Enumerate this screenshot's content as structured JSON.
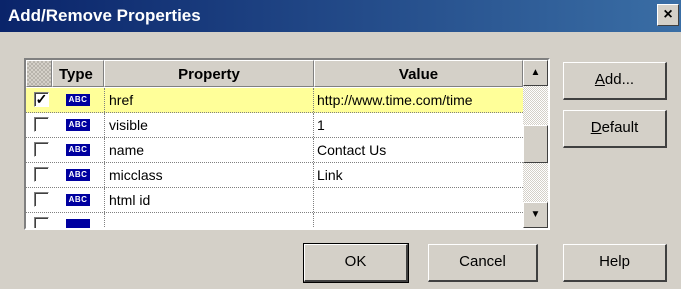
{
  "window": {
    "title": "Add/Remove Properties",
    "close_glyph": "×"
  },
  "grid": {
    "columns": {
      "type": "Type",
      "property": "Property",
      "value": "Value"
    },
    "rows": [
      {
        "checked": true,
        "type_badge": "ABC",
        "property": "href",
        "value": "http://www.time.com/time"
      },
      {
        "checked": false,
        "type_badge": "ABC",
        "property": "visible",
        "value": "1"
      },
      {
        "checked": false,
        "type_badge": "ABC",
        "property": "name",
        "value": "Contact Us"
      },
      {
        "checked": false,
        "type_badge": "ABC",
        "property": "micclass",
        "value": "Link"
      },
      {
        "checked": false,
        "type_badge": "ABC",
        "property": "html id",
        "value": ""
      }
    ],
    "scroll_up_glyph": "▲",
    "scroll_down_glyph": "▼"
  },
  "buttons": {
    "add": {
      "mnemonic": "A",
      "rest": "dd..."
    },
    "default": {
      "mnemonic": "D",
      "rest": "efault"
    },
    "ok": "OK",
    "cancel": "Cancel",
    "help": "Help"
  },
  "colors": {
    "title_bar": "#0a246a",
    "selected_row": "#ffff99",
    "dialog_bg": "#d4d0c8",
    "type_badge": "#0000a0"
  },
  "icons": {
    "type_badge": "string-type-icon",
    "checkbox_checked": "checkmark-icon"
  }
}
